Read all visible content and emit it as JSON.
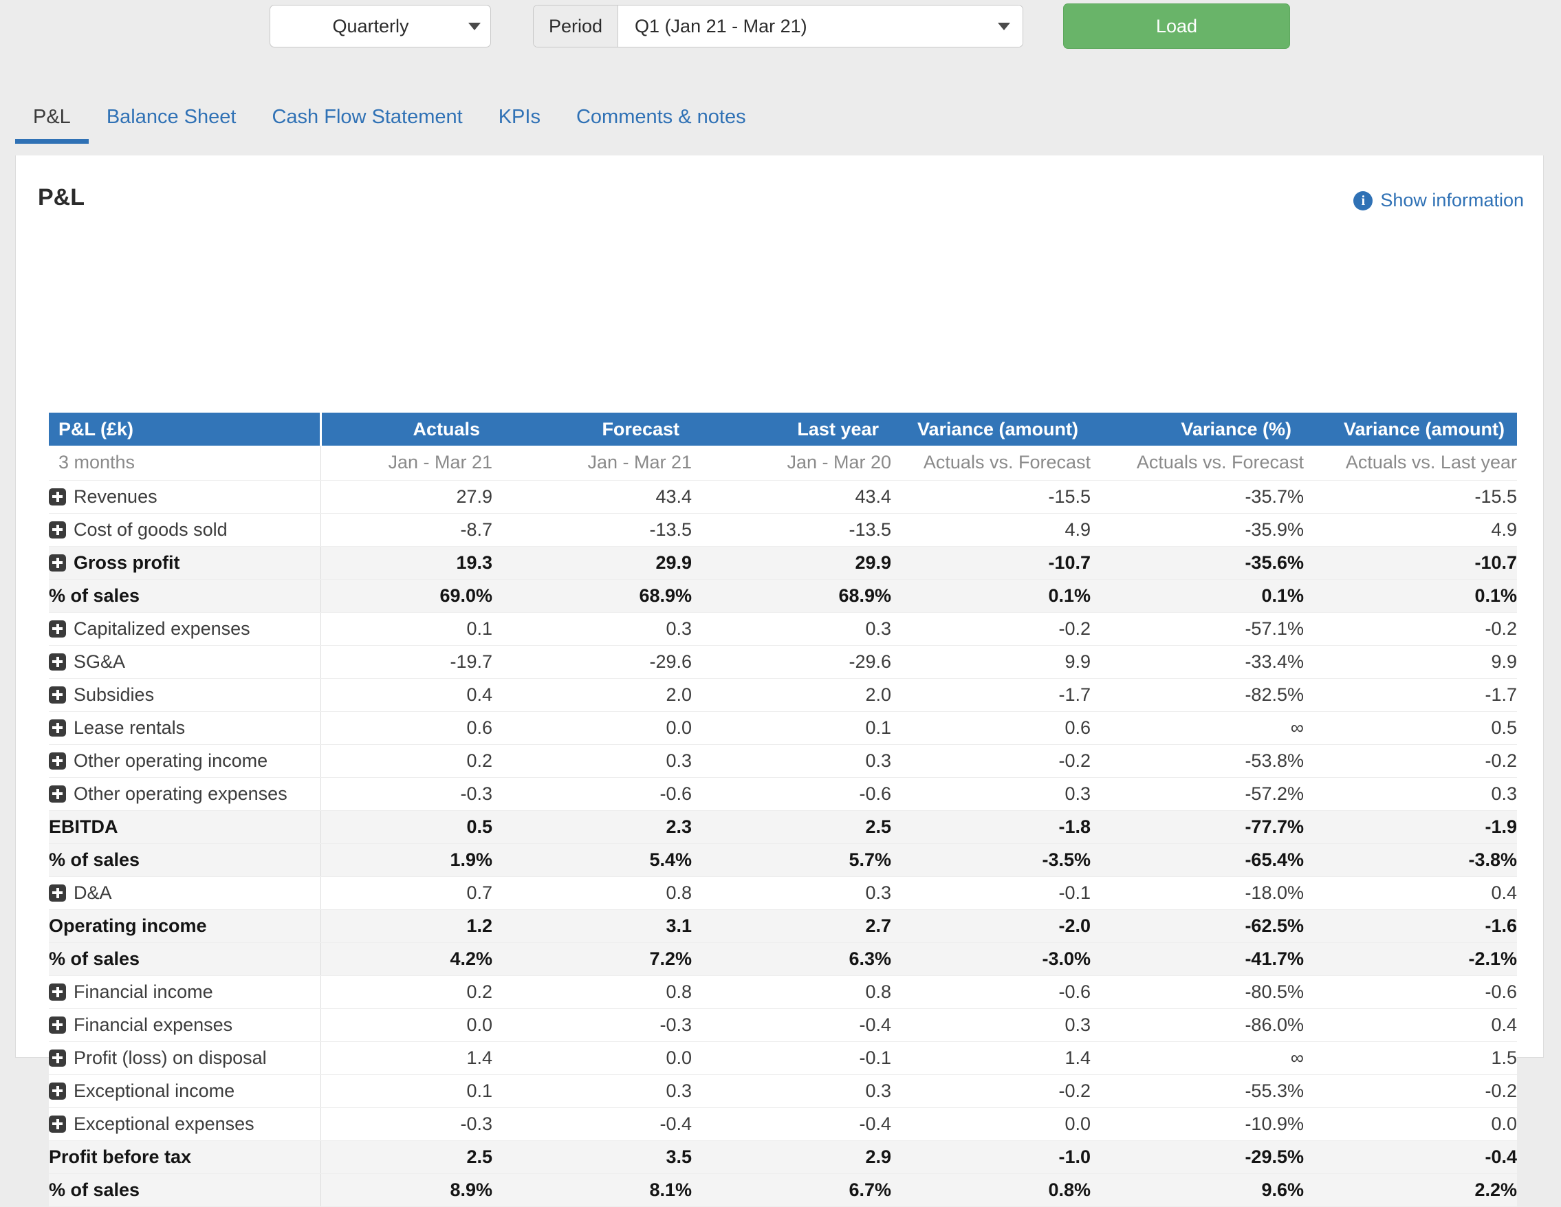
{
  "toolbar": {
    "frequency_value": "Quarterly",
    "period_label": "Period",
    "period_value": "Q1 (Jan 21 - Mar 21)",
    "load_label": "Load"
  },
  "tabs": [
    {
      "label": "P&L",
      "active": true
    },
    {
      "label": "Balance Sheet",
      "active": false
    },
    {
      "label": "Cash Flow Statement",
      "active": false
    },
    {
      "label": "KPIs",
      "active": false
    },
    {
      "label": "Comments & notes",
      "active": false
    }
  ],
  "card": {
    "title": "P&L",
    "show_information_label": "Show information",
    "info_icon": "info-circle-icon"
  },
  "colors": {
    "header_blue": "#3275b8",
    "link_blue": "#2f71b5",
    "load_green": "#69b469",
    "zebra": "#f4f4f4",
    "page_bg": "#ececec"
  },
  "table": {
    "headers": [
      "P&L (£k)",
      "Actuals",
      "Forecast",
      "Last year",
      "Variance (amount)",
      "Variance (%)",
      "Variance (amount)"
    ],
    "subheaders": [
      "3 months",
      "Jan - Mar 21",
      "Jan - Mar 21",
      "Jan - Mar 20",
      "Actuals vs. Forecast",
      "Actuals vs. Forecast",
      "Actuals vs. Last year"
    ],
    "rows": [
      {
        "label": "Revenues",
        "expandable": true,
        "bold": false,
        "zebra": false,
        "values": [
          "27.9",
          "43.4",
          "43.4",
          "-15.5",
          "-35.7%",
          "-15.5"
        ]
      },
      {
        "label": "Cost of goods sold",
        "expandable": true,
        "bold": false,
        "zebra": false,
        "values": [
          "-8.7",
          "-13.5",
          "-13.5",
          "4.9",
          "-35.9%",
          "4.9"
        ]
      },
      {
        "label": "Gross profit",
        "expandable": true,
        "bold": true,
        "zebra": true,
        "values": [
          "19.3",
          "29.9",
          "29.9",
          "-10.7",
          "-35.6%",
          "-10.7"
        ]
      },
      {
        "label": "% of sales",
        "expandable": false,
        "bold": true,
        "zebra": true,
        "values": [
          "69.0%",
          "68.9%",
          "68.9%",
          "0.1%",
          "0.1%",
          "0.1%"
        ]
      },
      {
        "label": "Capitalized expenses",
        "expandable": true,
        "bold": false,
        "zebra": false,
        "values": [
          "0.1",
          "0.3",
          "0.3",
          "-0.2",
          "-57.1%",
          "-0.2"
        ]
      },
      {
        "label": "SG&A",
        "expandable": true,
        "bold": false,
        "zebra": false,
        "values": [
          "-19.7",
          "-29.6",
          "-29.6",
          "9.9",
          "-33.4%",
          "9.9"
        ]
      },
      {
        "label": "Subsidies",
        "expandable": true,
        "bold": false,
        "zebra": false,
        "values": [
          "0.4",
          "2.0",
          "2.0",
          "-1.7",
          "-82.5%",
          "-1.7"
        ]
      },
      {
        "label": "Lease rentals",
        "expandable": true,
        "bold": false,
        "zebra": false,
        "values": [
          "0.6",
          "0.0",
          "0.1",
          "0.6",
          "∞",
          "0.5"
        ]
      },
      {
        "label": "Other operating income",
        "expandable": true,
        "bold": false,
        "zebra": false,
        "values": [
          "0.2",
          "0.3",
          "0.3",
          "-0.2",
          "-53.8%",
          "-0.2"
        ]
      },
      {
        "label": "Other operating expenses",
        "expandable": true,
        "bold": false,
        "zebra": false,
        "values": [
          "-0.3",
          "-0.6",
          "-0.6",
          "0.3",
          "-57.2%",
          "0.3"
        ]
      },
      {
        "label": "EBITDA",
        "expandable": false,
        "bold": true,
        "zebra": true,
        "values": [
          "0.5",
          "2.3",
          "2.5",
          "-1.8",
          "-77.7%",
          "-1.9"
        ]
      },
      {
        "label": "% of sales",
        "expandable": false,
        "bold": true,
        "zebra": true,
        "values": [
          "1.9%",
          "5.4%",
          "5.7%",
          "-3.5%",
          "-65.4%",
          "-3.8%"
        ]
      },
      {
        "label": "D&A",
        "expandable": true,
        "bold": false,
        "zebra": false,
        "values": [
          "0.7",
          "0.8",
          "0.3",
          "-0.1",
          "-18.0%",
          "0.4"
        ]
      },
      {
        "label": "Operating income",
        "expandable": false,
        "bold": true,
        "zebra": true,
        "values": [
          "1.2",
          "3.1",
          "2.7",
          "-2.0",
          "-62.5%",
          "-1.6"
        ]
      },
      {
        "label": "% of sales",
        "expandable": false,
        "bold": true,
        "zebra": true,
        "values": [
          "4.2%",
          "7.2%",
          "6.3%",
          "-3.0%",
          "-41.7%",
          "-2.1%"
        ]
      },
      {
        "label": "Financial income",
        "expandable": true,
        "bold": false,
        "zebra": false,
        "values": [
          "0.2",
          "0.8",
          "0.8",
          "-0.6",
          "-80.5%",
          "-0.6"
        ]
      },
      {
        "label": "Financial expenses",
        "expandable": true,
        "bold": false,
        "zebra": false,
        "values": [
          "0.0",
          "-0.3",
          "-0.4",
          "0.3",
          "-86.0%",
          "0.4"
        ]
      },
      {
        "label": "Profit (loss) on disposal",
        "expandable": true,
        "bold": false,
        "zebra": false,
        "values": [
          "1.4",
          "0.0",
          "-0.1",
          "1.4",
          "∞",
          "1.5"
        ]
      },
      {
        "label": "Exceptional income",
        "expandable": true,
        "bold": false,
        "zebra": false,
        "values": [
          "0.1",
          "0.3",
          "0.3",
          "-0.2",
          "-55.3%",
          "-0.2"
        ]
      },
      {
        "label": "Exceptional expenses",
        "expandable": true,
        "bold": false,
        "zebra": false,
        "values": [
          "-0.3",
          "-0.4",
          "-0.4",
          "0.0",
          "-10.9%",
          "0.0"
        ]
      },
      {
        "label": "Profit before tax",
        "expandable": false,
        "bold": true,
        "zebra": true,
        "values": [
          "2.5",
          "3.5",
          "2.9",
          "-1.0",
          "-29.5%",
          "-0.4"
        ]
      },
      {
        "label": "% of sales",
        "expandable": false,
        "bold": true,
        "zebra": true,
        "values": [
          "8.9%",
          "8.1%",
          "6.7%",
          "0.8%",
          "9.6%",
          "2.2%"
        ]
      }
    ]
  }
}
